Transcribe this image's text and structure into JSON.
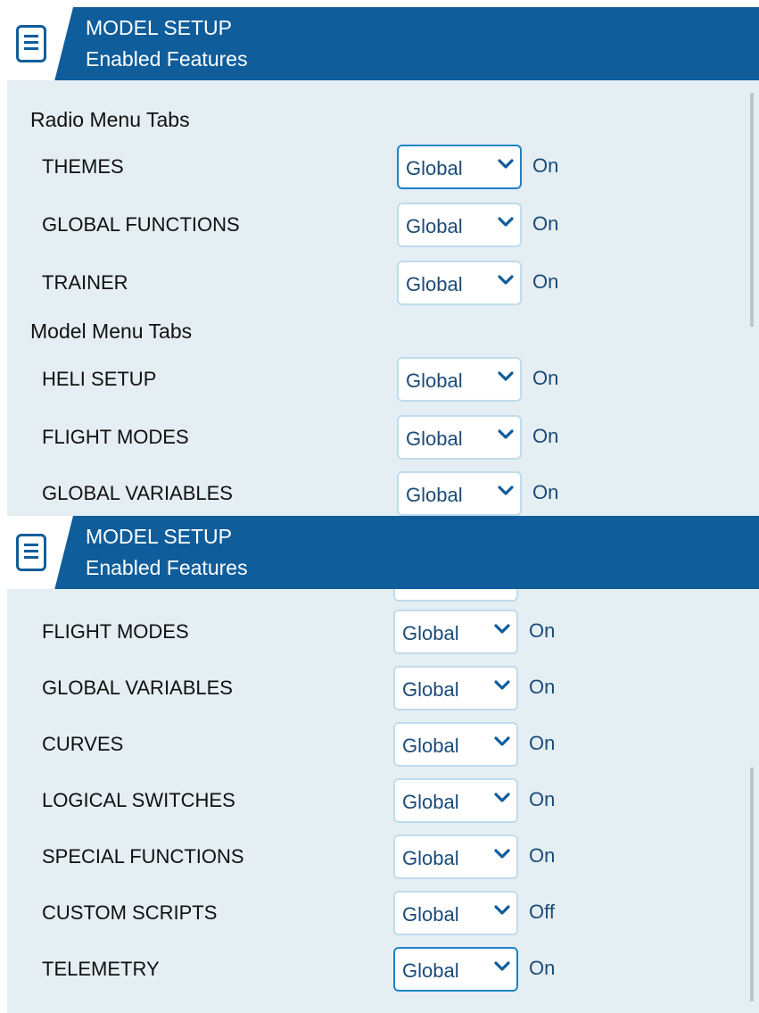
{
  "screens": [
    {
      "header": {
        "title": "MODEL SETUP",
        "subtitle": "Enabled Features"
      },
      "sections": [
        {
          "label": "Radio Menu Tabs",
          "rows": [
            {
              "label": "THEMES",
              "value": "Global",
              "status": "On",
              "focused": true
            },
            {
              "label": "GLOBAL FUNCTIONS",
              "value": "Global",
              "status": "On"
            },
            {
              "label": "TRAINER",
              "value": "Global",
              "status": "On"
            }
          ]
        },
        {
          "label": "Model Menu Tabs",
          "rows": [
            {
              "label": "HELI SETUP",
              "value": "Global",
              "status": "On"
            },
            {
              "label": "FLIGHT MODES",
              "value": "Global",
              "status": "On"
            },
            {
              "label": "GLOBAL VARIABLES",
              "value": "Global",
              "status": "On"
            }
          ]
        }
      ]
    },
    {
      "header": {
        "title": "MODEL SETUP",
        "subtitle": "Enabled Features"
      },
      "rows": [
        {
          "label": "FLIGHT MODES",
          "value": "Global",
          "status": "On"
        },
        {
          "label": "GLOBAL VARIABLES",
          "value": "Global",
          "status": "On"
        },
        {
          "label": "CURVES",
          "value": "Global",
          "status": "On"
        },
        {
          "label": "LOGICAL SWITCHES",
          "value": "Global",
          "status": "On"
        },
        {
          "label": "SPECIAL FUNCTIONS",
          "value": "Global",
          "status": "On"
        },
        {
          "label": "CUSTOM SCRIPTS",
          "value": "Global",
          "status": "Off"
        },
        {
          "label": "TELEMETRY",
          "value": "Global",
          "status": "On",
          "focused": true
        }
      ]
    }
  ],
  "icons": {
    "menu": "menu-icon",
    "dropdown": "chevron-down-icon"
  },
  "colors": {
    "header_bg": "#0f5d9b",
    "panel_bg": "#e5eef3",
    "accent": "#1c84c8",
    "value_text": "#1a4b78"
  }
}
